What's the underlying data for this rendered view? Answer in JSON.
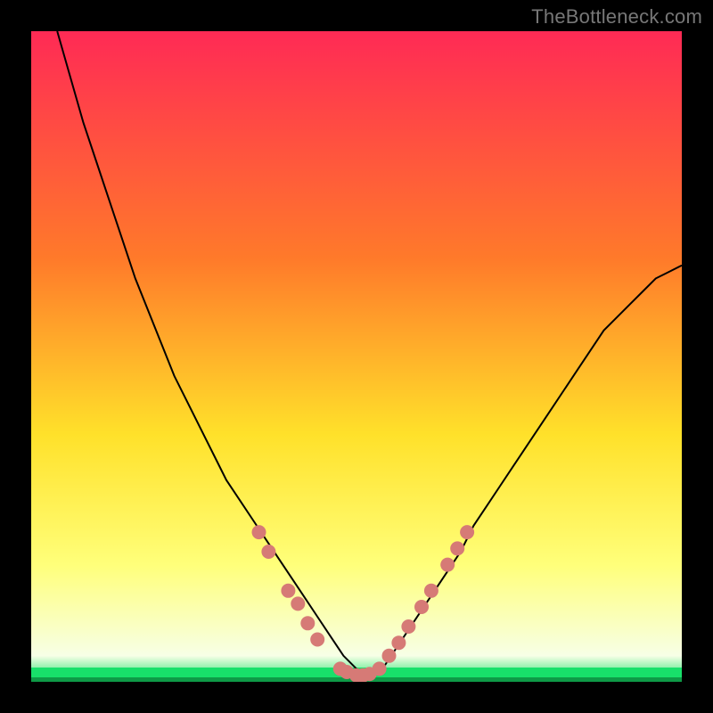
{
  "attribution": "TheBottleneck.com",
  "colors": {
    "frame_bg": "#000000",
    "curve": "#000000",
    "marker_fill": "#d67a76",
    "green_band": "#18e06a",
    "gradient_top": "#ff2a55",
    "gradient_mid1": "#ff7a2a",
    "gradient_mid2": "#ffe12a",
    "gradient_low": "#ffff7a",
    "gradient_bottom": "#f7ffe6"
  },
  "chart_data": {
    "type": "line",
    "title": "",
    "xlabel": "",
    "ylabel": "",
    "xlim": [
      0,
      100
    ],
    "ylim": [
      0,
      100
    ],
    "annotations": [],
    "x": [
      4,
      6,
      8,
      10,
      12,
      14,
      16,
      18,
      20,
      22,
      24,
      26,
      28,
      30,
      32,
      34,
      36,
      38,
      40,
      42,
      44,
      46,
      48,
      50,
      52,
      54,
      56,
      58,
      60,
      62,
      64,
      66,
      68,
      70,
      72,
      74,
      76,
      78,
      80,
      82,
      84,
      86,
      88,
      90,
      92,
      94,
      96,
      98,
      100
    ],
    "series": [
      {
        "name": "bottleneck-curve",
        "values": [
          100,
          93,
          86,
          80,
          74,
          68,
          62,
          57,
          52,
          47,
          43,
          39,
          35,
          31,
          28,
          25,
          22,
          19,
          16,
          13,
          10,
          7,
          4,
          2,
          1,
          2,
          5,
          8,
          11,
          14,
          17,
          20,
          24,
          27,
          30,
          33,
          36,
          39,
          42,
          45,
          48,
          51,
          54,
          56,
          58,
          60,
          62,
          63,
          64
        ]
      }
    ],
    "markers": [
      {
        "x": 35,
        "y": 23
      },
      {
        "x": 36.5,
        "y": 20
      },
      {
        "x": 39.5,
        "y": 14
      },
      {
        "x": 41,
        "y": 12
      },
      {
        "x": 42.5,
        "y": 9
      },
      {
        "x": 44,
        "y": 6.5
      },
      {
        "x": 47.5,
        "y": 2
      },
      {
        "x": 48.5,
        "y": 1.5
      },
      {
        "x": 50,
        "y": 1
      },
      {
        "x": 51,
        "y": 1
      },
      {
        "x": 52,
        "y": 1.2
      },
      {
        "x": 53.5,
        "y": 2
      },
      {
        "x": 55,
        "y": 4
      },
      {
        "x": 56.5,
        "y": 6
      },
      {
        "x": 58,
        "y": 8.5
      },
      {
        "x": 60,
        "y": 11.5
      },
      {
        "x": 61.5,
        "y": 14
      },
      {
        "x": 64,
        "y": 18
      },
      {
        "x": 65.5,
        "y": 20.5
      },
      {
        "x": 67,
        "y": 23
      }
    ]
  }
}
